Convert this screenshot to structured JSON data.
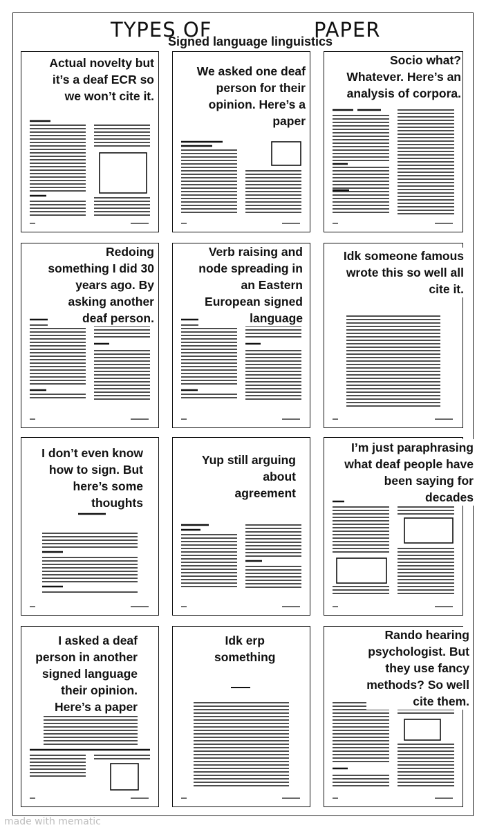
{
  "header": {
    "title_left": "TYPES OF",
    "title_right": "PAPER",
    "subtitle": "Signed language linguistics"
  },
  "panels": [
    {
      "caption": [
        "Actual novelty but",
        "it’s a deaf ECR so",
        "we won’t cite it."
      ]
    },
    {
      "caption": [
        "We asked one deaf",
        "person for their",
        "opinion. Here’s a",
        "paper"
      ]
    },
    {
      "caption": [
        "Socio what?",
        "Whatever. Here’s an",
        "analysis of corpora."
      ]
    },
    {
      "caption": [
        "Redoing",
        "something I did 30",
        "years ago. By",
        "asking another",
        "deaf person."
      ]
    },
    {
      "caption": [
        "Verb raising and",
        "node spreading in",
        "an Eastern",
        "European signed",
        "language"
      ]
    },
    {
      "caption": [
        "Idk someone famous",
        "wrote this so well all",
        "cite it."
      ]
    },
    {
      "caption": [
        "I don’t even know",
        "how to sign. But",
        "here’s some",
        "thoughts"
      ]
    },
    {
      "caption": [
        "Yup still arguing",
        "about",
        "agreement"
      ]
    },
    {
      "caption": [
        "I’m just paraphrasing",
        "what deaf people have",
        "been saying for",
        "decades"
      ]
    },
    {
      "caption": [
        "I asked a deaf",
        "person in another",
        "signed language",
        "their opinion.",
        "Here’s a paper"
      ]
    },
    {
      "caption": [
        "Idk erp",
        "something"
      ]
    },
    {
      "caption": [
        "Rando hearing",
        "psychologist. But",
        "they use fancy",
        "methods? So well",
        "cite them."
      ]
    }
  ],
  "watermark": "made with mematic"
}
